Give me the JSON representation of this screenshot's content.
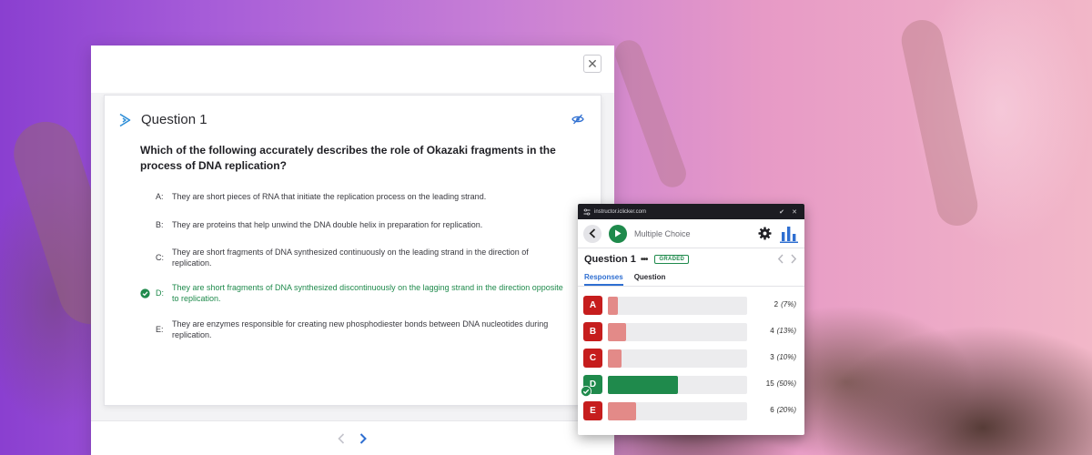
{
  "question": {
    "title": "Question 1",
    "text": "Which of the following accurately describes the role of Okazaki fragments in the process of DNA replication?",
    "answers": [
      {
        "letter": "A:",
        "text": "They are short pieces of RNA that initiate the replication process on the leading strand.",
        "correct": false
      },
      {
        "letter": "B:",
        "text": "They are proteins that help unwind the DNA double helix in preparation for replication.",
        "correct": false
      },
      {
        "letter": "C:",
        "text": "They are short fragments of DNA synthesized continuously on the leading strand in the direction of replication.",
        "correct": false
      },
      {
        "letter": "D:",
        "text": "They are short fragments of DNA synthesized discontinuously on the lagging strand in the direction opposite to replication.",
        "correct": true
      },
      {
        "letter": "E:",
        "text": "They are enzymes responsible for creating new phosphodiester bonds between DNA nucleotides during replication.",
        "correct": false
      }
    ]
  },
  "modal": {
    "close_icon": "close-icon",
    "close_glyph": "✕",
    "prev_icon": "chevron-left-icon",
    "next_icon": "chevron-right-icon"
  },
  "widget": {
    "url": "instructor.iclicker.com",
    "mode": "Multiple Choice",
    "question_title": "Question 1",
    "more_glyph": "•••",
    "status_badge": "GRADED",
    "tabs": [
      {
        "label": "Responses",
        "active": true
      },
      {
        "label": "Question",
        "active": false
      }
    ],
    "pin_glyph": "✔",
    "close_glyph": "✕",
    "responses": [
      {
        "letter": "A",
        "count": "2",
        "percent": "(7%)",
        "share": 0.07,
        "correct": false
      },
      {
        "letter": "B",
        "count": "4",
        "percent": "(13%)",
        "share": 0.13,
        "correct": false
      },
      {
        "letter": "C",
        "count": "3",
        "percent": "(10%)",
        "share": 0.1,
        "correct": false
      },
      {
        "letter": "D",
        "count": "15",
        "percent": "(50%)",
        "share": 0.5,
        "correct": true
      },
      {
        "letter": "E",
        "count": "6",
        "percent": "(20%)",
        "share": 0.2,
        "correct": false
      }
    ]
  },
  "colors": {
    "correct_green": "#1f8a4c",
    "wrong_red": "#c61d1d",
    "wrong_bar": "#e38a88",
    "accent_blue": "#2f6fd1"
  }
}
